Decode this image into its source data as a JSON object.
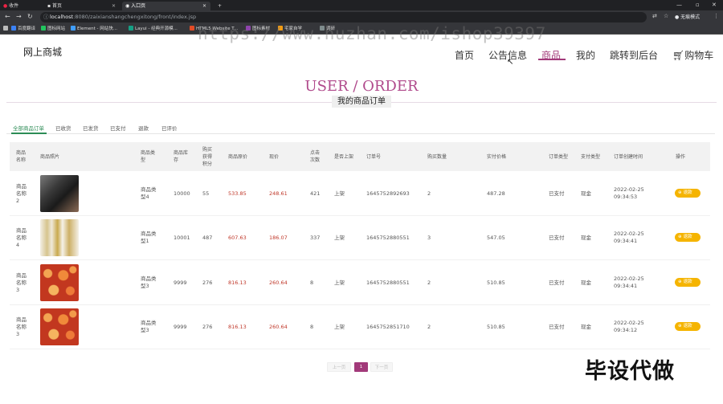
{
  "browser": {
    "tabs": [
      {
        "label": "收件"
      },
      {
        "label": "首页"
      },
      {
        "label": "入口页"
      }
    ],
    "new_tab_glyph": "+",
    "url_host": "localhost",
    "url_rest": ":8080/zaixianshangchengxitong/front/index.jsp",
    "incognito_label": "无痕模式",
    "bookmarks": [
      {
        "label": "百度翻译",
        "color": "#3b82f6"
      },
      {
        "label": "图标网站",
        "color": "#22c55e"
      },
      {
        "label": "Element - 网站快...",
        "color": "#409eff"
      },
      {
        "label": "Layui - 经典开源模...",
        "color": "#16a085"
      },
      {
        "label": "HTML5 Website T...",
        "color": "#e34c26"
      },
      {
        "label": "图标素材",
        "color": "#8e44ad"
      },
      {
        "label": "宅家自学",
        "color": "#f39c12"
      },
      {
        "label": "调研",
        "color": "#7f8c8d"
      }
    ]
  },
  "watermark": "https://www.huzhan.com/ishop39397",
  "site": {
    "logo": "网上商城",
    "nav": [
      "首页",
      "公告信息",
      "商品",
      "我的",
      "跳转到后台",
      "购物车"
    ],
    "cart_icon": "cart-icon"
  },
  "page": {
    "title_en": "USER / ORDER",
    "title_cn": "我的商品订单"
  },
  "order_tabs": [
    "全部商品订单",
    "已收货",
    "已发货",
    "已支付",
    "退款",
    "已评价"
  ],
  "table": {
    "headers": [
      "商品\n名称",
      "商品照片",
      "商品类\n型",
      "商品库\n存",
      "购买\n获得\n积分",
      "商品原价",
      "现价",
      "点击\n次数",
      "是否上架",
      "订单号",
      "购买数量",
      "实付价格",
      "订单类型",
      "支付类型",
      "订单创建时间",
      "操作"
    ],
    "rows": [
      {
        "name": "商品\n名称\n2",
        "img": "phone",
        "type": "商品类\n型4",
        "stock": "10000",
        "points": "55",
        "orig": "533.85",
        "price": "248.61",
        "clicks": "421",
        "shelf": "上架",
        "order_no": "1645752892693",
        "qty": "2",
        "paid": "487.28",
        "otype": "已支付",
        "ptype": "现金",
        "time": "2022-02-25\n09:34:53",
        "op": "退款"
      },
      {
        "name": "商品\n名称\n4",
        "img": "bottles",
        "type": "商品类\n型1",
        "stock": "10001",
        "points": "487",
        "orig": "607.63",
        "price": "186.07",
        "clicks": "337",
        "shelf": "上架",
        "order_no": "1645752880551",
        "qty": "3",
        "paid": "547.05",
        "otype": "已支付",
        "ptype": "现金",
        "time": "2022-02-25\n09:34:41",
        "op": "退款"
      },
      {
        "name": "商品\n名称\n3",
        "img": "flowers",
        "type": "商品类\n型3",
        "stock": "9999",
        "points": "276",
        "orig": "816.13",
        "price": "260.64",
        "clicks": "8",
        "shelf": "上架",
        "order_no": "1645752880551",
        "qty": "2",
        "paid": "510.85",
        "otype": "已支付",
        "ptype": "现金",
        "time": "2022-02-25\n09:34:41",
        "op": "退款"
      },
      {
        "name": "商品\n名称\n3",
        "img": "flowers",
        "type": "商品类\n型3",
        "stock": "9999",
        "points": "276",
        "orig": "816.13",
        "price": "260.64",
        "clicks": "8",
        "shelf": "上架",
        "order_no": "1645752851710",
        "qty": "2",
        "paid": "510.85",
        "otype": "已支付",
        "ptype": "现金",
        "time": "2022-02-25\n09:34:12",
        "op": "退款"
      }
    ]
  },
  "pagination": {
    "prev": "上一页",
    "current": "1",
    "next": "下一页"
  },
  "promo_text": "毕设代做"
}
